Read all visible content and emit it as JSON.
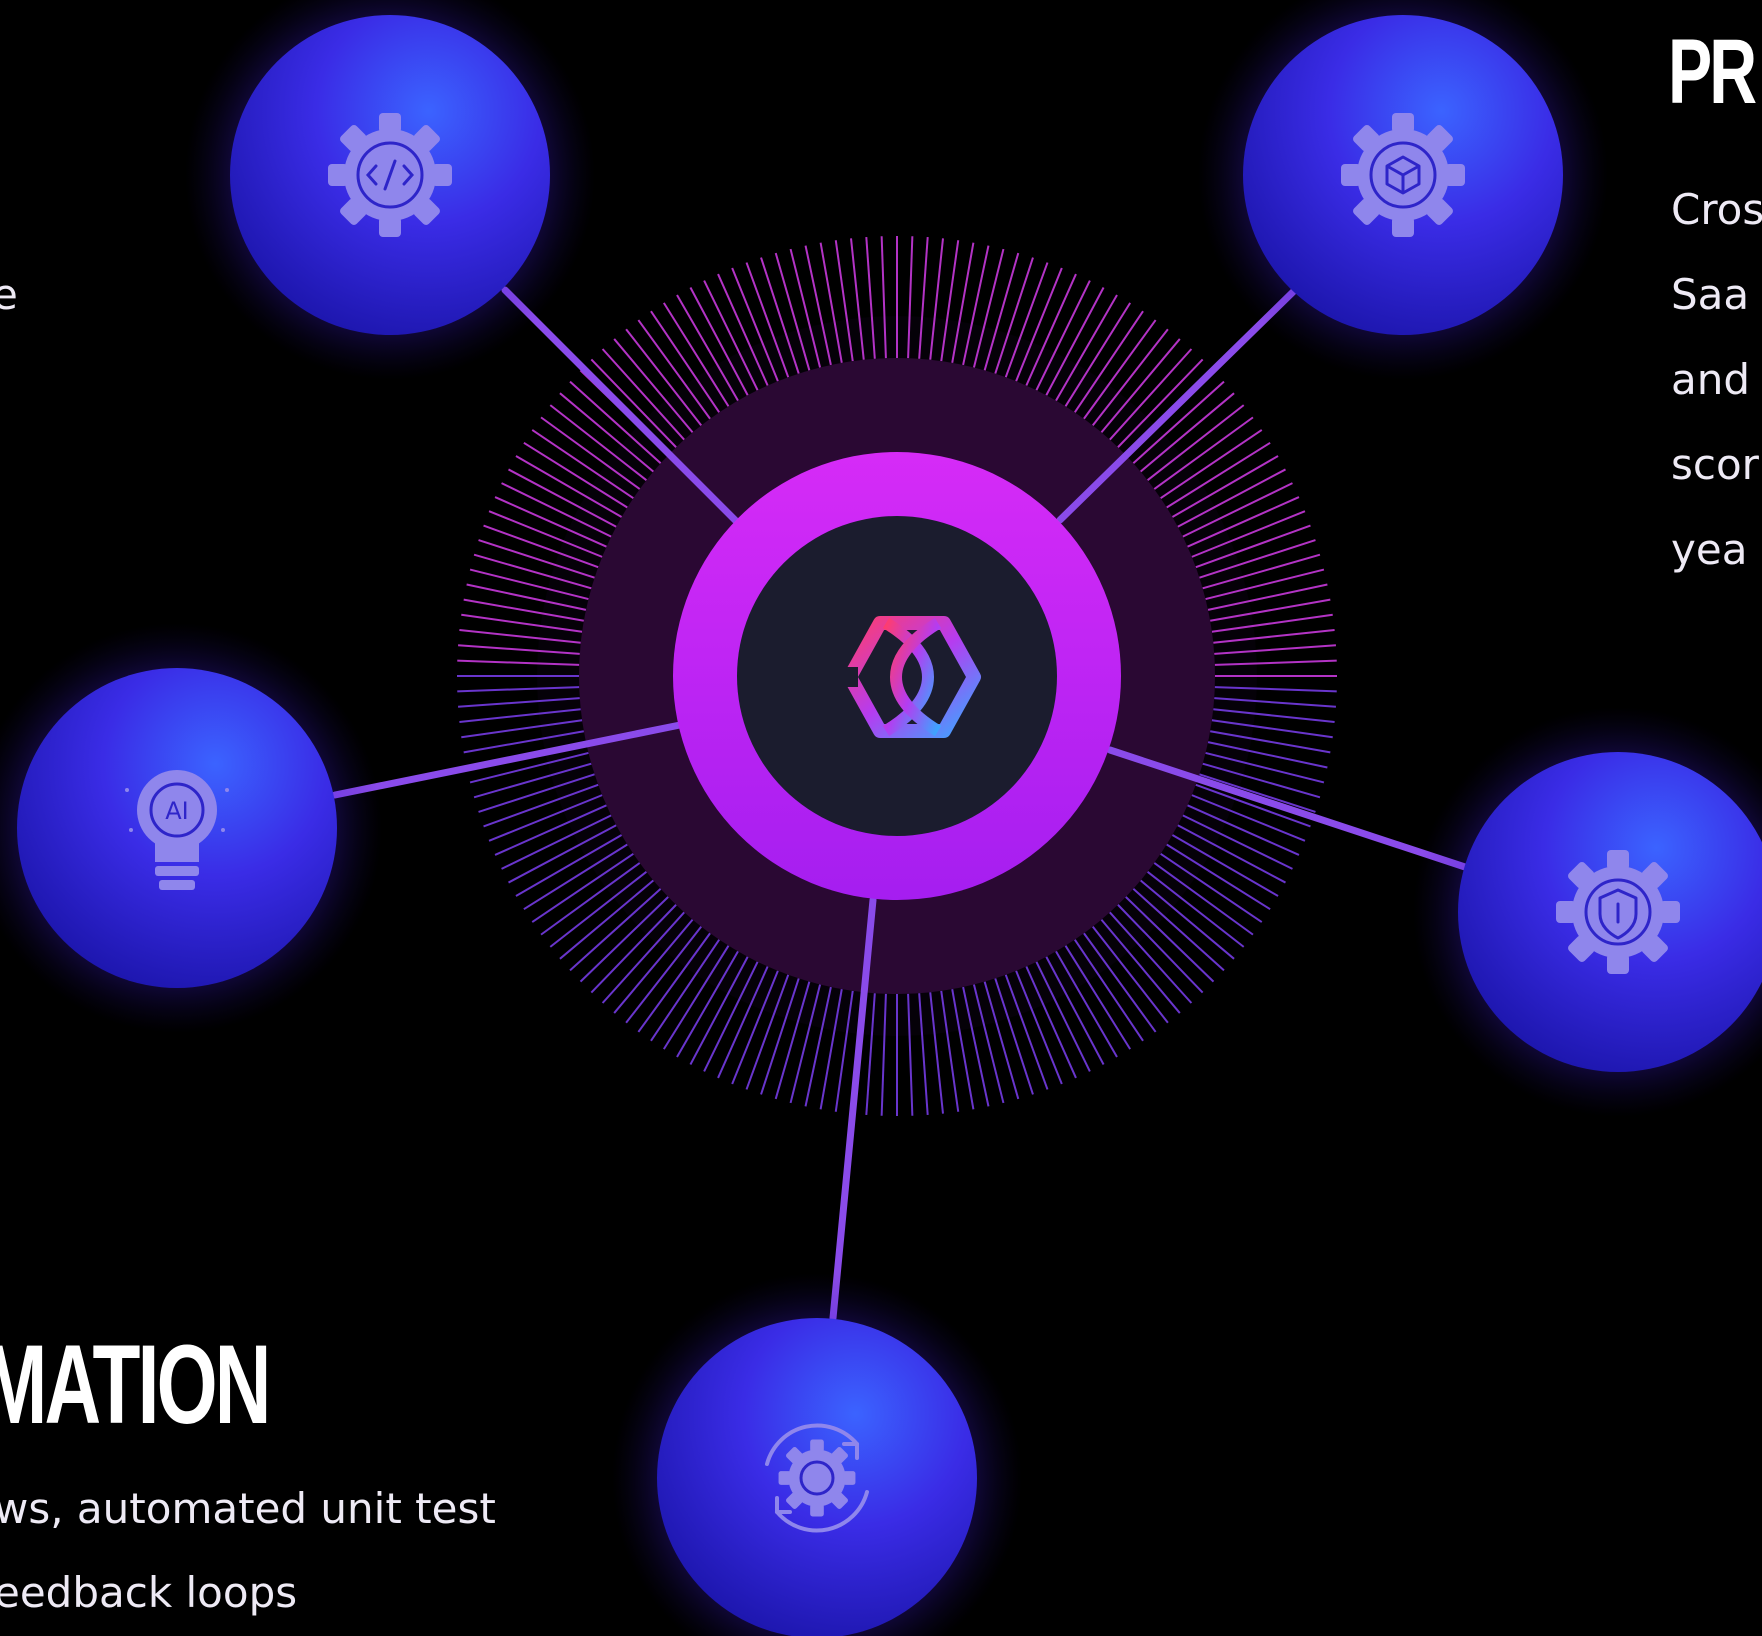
{
  "left_fragment": {
    "line": "e"
  },
  "top_right_feature": {
    "heading": "PR",
    "lines": [
      "Cros",
      "Saa",
      "and",
      "scor",
      "yea"
    ]
  },
  "bottom_left_feature": {
    "heading": "MATION",
    "lines": [
      "ws, automated unit test",
      "eedback loops"
    ]
  },
  "nodes": [
    {
      "id": "code-gear",
      "icon": "code-gear-icon"
    },
    {
      "id": "box-gear",
      "icon": "box-gear-icon"
    },
    {
      "id": "ai-bulb",
      "icon": "ai-lightbulb-icon"
    },
    {
      "id": "shield-gear",
      "icon": "shield-gear-icon"
    },
    {
      "id": "sync-gear",
      "icon": "sync-gear-icon"
    }
  ],
  "hub": {
    "logo": "brand-logo-icon"
  },
  "colors": {
    "background": "#000000",
    "ring_magenta": "#c528f5",
    "hub_dark": "#1b1c2e",
    "node_blue": "#3a2ce0",
    "connector": "#8a4bea",
    "icon_lavender": "#8f86ec"
  }
}
